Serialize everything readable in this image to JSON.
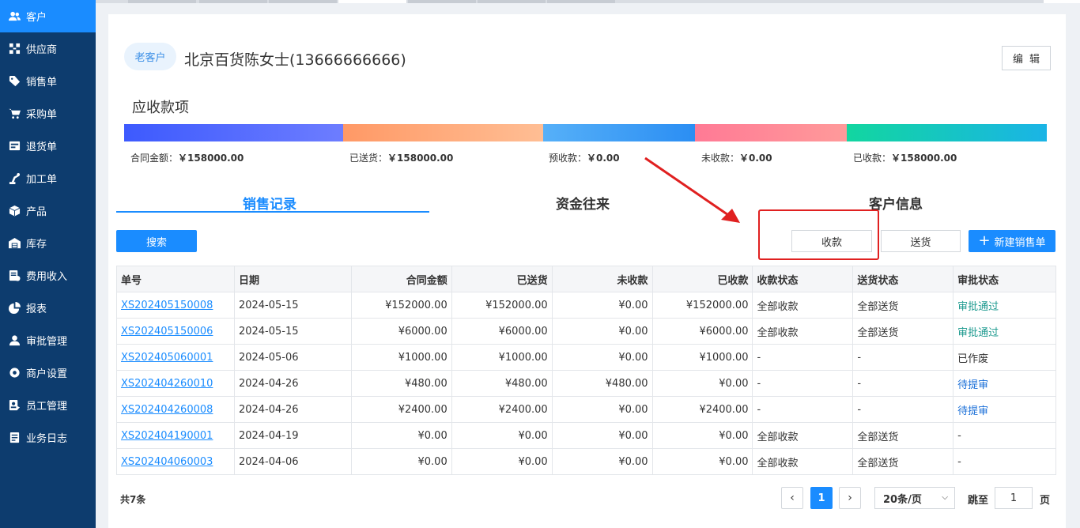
{
  "sidebar": {
    "items": [
      {
        "label": "客户",
        "icon": "users-icon"
      },
      {
        "label": "供应商",
        "icon": "supplier-icon"
      },
      {
        "label": "销售单",
        "icon": "tag-icon"
      },
      {
        "label": "采购单",
        "icon": "cart-icon"
      },
      {
        "label": "退货单",
        "icon": "return-icon"
      },
      {
        "label": "加工单",
        "icon": "robot-arm-icon"
      },
      {
        "label": "产品",
        "icon": "cube-icon"
      },
      {
        "label": "库存",
        "icon": "warehouse-icon"
      },
      {
        "label": "费用收入",
        "icon": "money-icon"
      },
      {
        "label": "报表",
        "icon": "pie-chart-icon"
      },
      {
        "label": "审批管理",
        "icon": "user-icon"
      },
      {
        "label": "商户设置",
        "icon": "gear-icon"
      },
      {
        "label": "员工管理",
        "icon": "staff-icon"
      },
      {
        "label": "业务日志",
        "icon": "log-icon"
      }
    ]
  },
  "customer": {
    "badge": "老客户",
    "name": "北京百货陈女士(13666666666)",
    "edit_label": "编辑"
  },
  "receivables": {
    "title": "应收款项",
    "colors": [
      "#3d5afe",
      "#ff9966",
      "#3fa0f5",
      "#ff7a95",
      "#12d6a0"
    ],
    "items": [
      {
        "label": "合同金额：",
        "value": "￥158000.00"
      },
      {
        "label": "已送货：",
        "value": "￥158000.00"
      },
      {
        "label": "预收款：",
        "value": "￥0.00"
      },
      {
        "label": "未收款：",
        "value": "￥0.00"
      },
      {
        "label": "已收款：",
        "value": "￥158000.00"
      }
    ]
  },
  "tabs": [
    "销售记录",
    "资金往来",
    "客户信息"
  ],
  "actions": {
    "search": "搜索",
    "collect": "收款",
    "deliver": "送货",
    "new_order": "新建销售单"
  },
  "table": {
    "headers": [
      "单号",
      "日期",
      "合同金额",
      "已送货",
      "未收款",
      "已收款",
      "收款状态",
      "送货状态",
      "审批状态"
    ],
    "rows": [
      [
        "XS202405150008",
        "2024-05-15",
        "¥152000.00",
        "¥152000.00",
        "¥0.00",
        "¥152000.00",
        "全部收款",
        "全部送货",
        "审批通过"
      ],
      [
        "XS202405150006",
        "2024-05-15",
        "¥6000.00",
        "¥6000.00",
        "¥0.00",
        "¥6000.00",
        "全部收款",
        "全部送货",
        "审批通过"
      ],
      [
        "XS202405060001",
        "2024-05-06",
        "¥1000.00",
        "¥1000.00",
        "¥0.00",
        "¥1000.00",
        "-",
        "-",
        "已作废"
      ],
      [
        "XS202404260010",
        "2024-04-26",
        "¥480.00",
        "¥480.00",
        "¥480.00",
        "¥0.00",
        "-",
        "-",
        "待提审"
      ],
      [
        "XS202404260008",
        "2024-04-26",
        "¥2400.00",
        "¥2400.00",
        "¥0.00",
        "¥2400.00",
        "-",
        "-",
        "待提审"
      ],
      [
        "XS202404190001",
        "2024-04-19",
        "¥0.00",
        "¥0.00",
        "¥0.00",
        "¥0.00",
        "全部收款",
        "全部送货",
        "-"
      ],
      [
        "XS202404060003",
        "2024-04-06",
        "¥0.00",
        "¥0.00",
        "¥0.00",
        "¥0.00",
        "全部收款",
        "全部送货",
        "-"
      ]
    ]
  },
  "pagination": {
    "total": "共7条",
    "current": "1",
    "page_size": "20条/页",
    "jump_label": "跳至",
    "jump_value": "1",
    "unit": "页"
  }
}
